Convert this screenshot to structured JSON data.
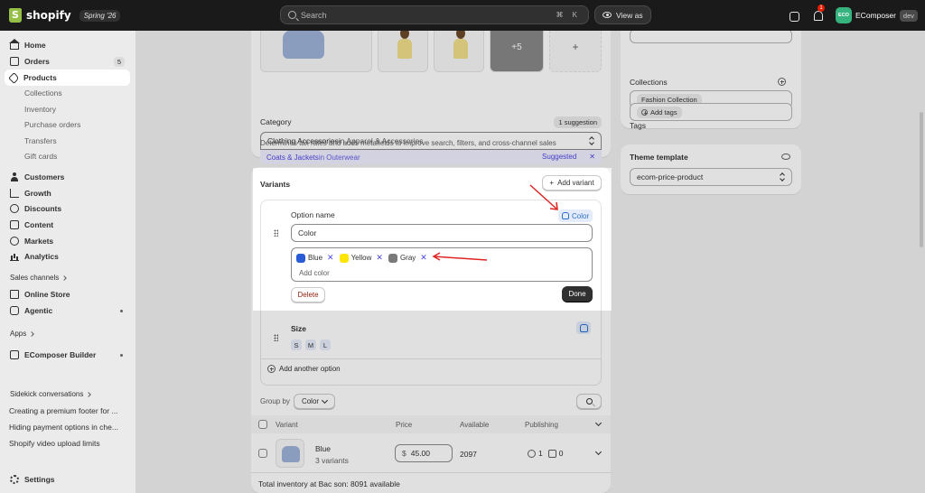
{
  "topbar": {
    "brand": "shopify",
    "edition": "Spring '26",
    "search_placeholder": "Search",
    "search_shortcut": "⌘ K",
    "view_as": "View as",
    "notification_count": "1",
    "avatar_initials": "ECO",
    "user_name": "EComposer",
    "env_badge": "dev"
  },
  "sidebar": {
    "items": [
      {
        "label": "Home"
      },
      {
        "label": "Orders",
        "badge": "5"
      },
      {
        "label": "Products"
      },
      {
        "label": "Customers"
      },
      {
        "label": "Growth"
      },
      {
        "label": "Discounts"
      },
      {
        "label": "Content"
      },
      {
        "label": "Markets"
      },
      {
        "label": "Analytics"
      }
    ],
    "product_subitems": [
      "Collections",
      "Inventory",
      "Purchase orders",
      "Transfers",
      "Gift cards"
    ],
    "sales_channels_label": "Sales channels",
    "online_store": "Online Store",
    "agentic": "Agentic",
    "apps_label": "Apps",
    "ecomposer_builder": "EComposer Builder",
    "sidekick_label": "Sidekick conversations",
    "recent": [
      "Creating a premium footer for ...",
      "Hiding payment options in che...",
      "Shopify video upload limits"
    ],
    "settings": "Settings"
  },
  "media": {
    "more_count": "+5",
    "add": "+"
  },
  "category": {
    "label": "Category",
    "suggestion_badge": "1 suggestion",
    "value_main": "Clothing Accessories",
    "value_rest": " in Apparel & Accessories",
    "suggest_main": "Coats & Jackets",
    "suggest_rest": " in Outerwear",
    "suggested_label": "Suggested",
    "dismiss": "✕",
    "help": "Determines tax rates and adds metafields to improve search, filters, and cross-channel sales"
  },
  "variants": {
    "title": "Variants",
    "add_variant": "Add variant",
    "option_name_label": "Option name",
    "metafield_tag": "Color",
    "option_name_value": "Color",
    "values": [
      {
        "name": "Blue",
        "color": "#2a5bd7"
      },
      {
        "name": "Yellow",
        "color": "#ffe600"
      },
      {
        "name": "Gray",
        "color": "#7a7a7a"
      }
    ],
    "remove_glyph": "✕",
    "add_value_placeholder": "Add color",
    "delete": "Delete",
    "done": "Done",
    "size_label": "Size",
    "size_values": [
      "S",
      "M",
      "L"
    ],
    "add_another_option": "Add another option"
  },
  "table": {
    "group_by_label": "Group by",
    "group_by_value": "Color",
    "headers": [
      "Variant",
      "Price",
      "Available",
      "Publishing"
    ],
    "rows": [
      {
        "name": "Blue",
        "sub": "3 variants",
        "currency": "$",
        "price": "45.00",
        "available": "2097",
        "locations": "1",
        "channels": "0"
      }
    ],
    "total_inventory": "Total inventory at Bac son: 8091 available"
  },
  "right": {
    "collections_label": "Collections",
    "collection_chip": "Fashion Collection",
    "tags_label": "Tags",
    "add_tags": "Add tags",
    "theme_template_label": "Theme template",
    "theme_template_value": "ecom-price-product"
  },
  "colors": {
    "annotation_red": "#e02424",
    "accent_purple": "#4f47e5",
    "link_blue": "#2c6ecb"
  }
}
